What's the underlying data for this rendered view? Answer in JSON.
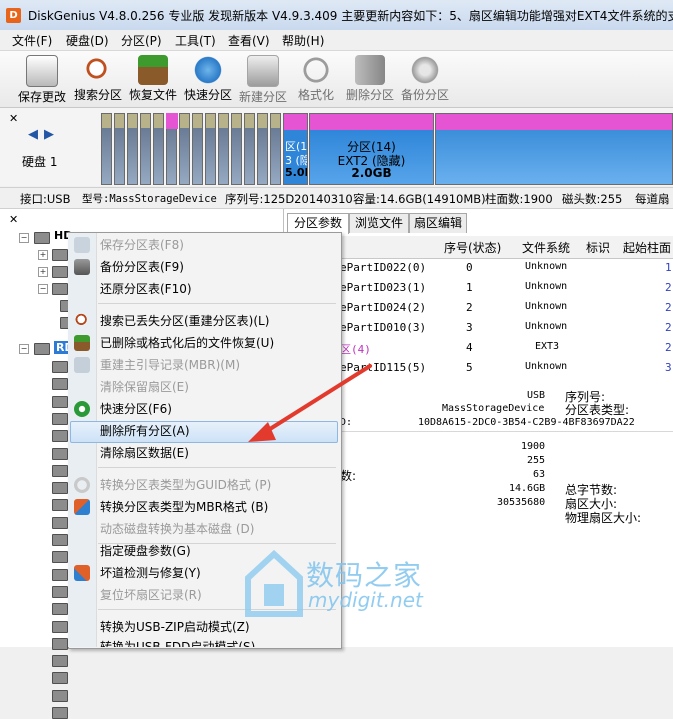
{
  "title_bar": {
    "app_icon_letter": "D",
    "title": "DiskGenius V4.8.0.256 专业版   发现新版本 V4.9.3.409 主要更新内容如下：5、扇区编辑功能增强对EXT4文件系统的支"
  },
  "menu": [
    "文件(F)",
    "硬盘(D)",
    "分区(P)",
    "工具(T)",
    "查看(V)",
    "帮助(H)"
  ],
  "toolbar": [
    {
      "label": "保存更改",
      "icon": "save-icon",
      "enabled": true
    },
    {
      "label": "搜索分区",
      "icon": "search-partition-icon",
      "enabled": true
    },
    {
      "label": "恢复文件",
      "icon": "recover-files-icon",
      "enabled": true
    },
    {
      "label": "快速分区",
      "icon": "quick-partition-icon",
      "enabled": true
    },
    {
      "label": "新建分区",
      "icon": "new-partition-icon",
      "enabled": false
    },
    {
      "label": "格式化",
      "icon": "format-icon",
      "enabled": false
    },
    {
      "label": "删除分区",
      "icon": "delete-partition-icon",
      "enabled": false
    },
    {
      "label": "备份分区",
      "icon": "backup-partition-icon",
      "enabled": false
    }
  ],
  "disk_map": {
    "disk_label": "硬盘 1",
    "partial_partition": {
      "line1": "区(1",
      "line2": "3 (隐",
      "line3": "5.0I"
    },
    "selected_partition": {
      "line1": "分区(14)",
      "line2": "EXT2 (隐藏)",
      "line3": "2.0GB"
    }
  },
  "info_line": {
    "interface": "接口:USB",
    "model": "型号:MassStorageDevice",
    "serial": "序列号:125D20140310",
    "capacity": "容量:14.6GB(14910MB)",
    "cylinders": "柱面数:1900",
    "heads": "磁头数:255",
    "sectors": "每道扇"
  },
  "tree": {
    "items": [
      "HD",
      "RD"
    ]
  },
  "tabs": [
    "分区参数",
    "浏览文件",
    "扇区编辑"
  ],
  "table": {
    "headers": [
      "序号(状态)",
      "文件系统",
      "标识",
      "起始柱面"
    ],
    "rows": [
      {
        "name": "ePartID022(0)",
        "index": "0",
        "fs": "Unknown",
        "id": "",
        "start": "1"
      },
      {
        "name": "ePartID023(1)",
        "index": "1",
        "fs": "Unknown",
        "id": "",
        "start": "2"
      },
      {
        "name": "ePartID024(2)",
        "index": "2",
        "fs": "Unknown",
        "id": "",
        "start": "2"
      },
      {
        "name": "ePartID010(3)",
        "index": "3",
        "fs": "Unknown",
        "id": "",
        "start": "2"
      },
      {
        "name": "区(4)",
        "index": "4",
        "fs": "EXT3",
        "id": "",
        "start": "2"
      },
      {
        "name": "ePartID115(5)",
        "index": "5",
        "fs": "Unknown",
        "id": "",
        "start": "3"
      }
    ]
  },
  "details": {
    "usb": "USB",
    "serial_label": "序列号:",
    "model": "MassStorageDevice",
    "ptype_label": "分区表类型:",
    "guid_prefix": "D:",
    "guid": "10D8A615-2DC0-3B54-C2B9-4BF83697DA22",
    "cylinders": "1900",
    "heads": "255",
    "sectors_label": "数:",
    "sectors": "63",
    "capacity": "14.6GB",
    "total_bytes_label": "总字节数:",
    "total_sectors": "30535680",
    "sector_size_label": "扇区大小:",
    "phys_sector_label": "物理扇区大小:"
  },
  "context_menu": [
    {
      "label": "保存分区表(F8)",
      "enabled": false,
      "icon": "save-icon"
    },
    {
      "label": "备份分区表(F9)",
      "enabled": true,
      "icon": "backup-table-icon"
    },
    {
      "label": "还原分区表(F10)",
      "enabled": true,
      "icon": ""
    },
    {
      "label": "搜索已丢失分区(重建分区表)(L)",
      "enabled": true,
      "icon": "search-icon"
    },
    {
      "label": "已删除或格式化后的文件恢复(U)",
      "enabled": true,
      "icon": "recover-icon"
    },
    {
      "label": "重建主引导记录(MBR)(M)",
      "enabled": false,
      "icon": "mbr-icon"
    },
    {
      "label": "清除保留扇区(E)",
      "enabled": false,
      "icon": ""
    },
    {
      "label": "快速分区(F6)",
      "enabled": true,
      "icon": "quick-partition-icon"
    },
    {
      "label": "删除所有分区(A)",
      "enabled": true,
      "icon": "",
      "highlighted": true
    },
    {
      "label": "清除扇区数据(E)",
      "enabled": true,
      "icon": ""
    },
    {
      "label": "转换分区表类型为GUID格式 (P)",
      "enabled": false,
      "icon": "convert-icon"
    },
    {
      "label": "转换分区表类型为MBR格式 (B)",
      "enabled": true,
      "icon": "convert-mbr-icon"
    },
    {
      "label": "动态磁盘转换为基本磁盘 (D)",
      "enabled": false,
      "icon": ""
    },
    {
      "label": "指定硬盘参数(G)",
      "enabled": true,
      "icon": ""
    },
    {
      "label": "坏道检测与修复(Y)",
      "enabled": true,
      "icon": "repair-icon"
    },
    {
      "label": "复位坏扇区记录(R)",
      "enabled": false,
      "icon": ""
    },
    {
      "label": "转换为USB-ZIP启动模式(Z)",
      "enabled": true,
      "icon": ""
    },
    {
      "label": "转换为USB-FDD启动模式(S)",
      "enabled": true,
      "icon": ""
    }
  ],
  "watermark": {
    "title": "数码之家",
    "url": "mydigit.net"
  },
  "colors": {
    "accent_blue": "#2e7bd6",
    "pink_bar": "#e454d3",
    "selected_partition": "#2f86d9",
    "arrow": "#e23b2e"
  }
}
